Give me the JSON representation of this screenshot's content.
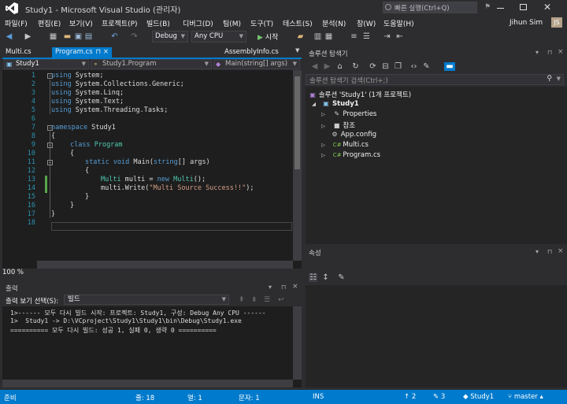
{
  "window": {
    "title": "Study1 - Microsoft Visual Studio (관리자)",
    "quick_launch_placeholder": "빠른 실행(Ctrl+Q)",
    "user": "Jihun Sim",
    "avatar_initials": "JS"
  },
  "menu": [
    "파일(F)",
    "편집(E)",
    "보기(V)",
    "프로젝트(P)",
    "빌드(B)",
    "디버그(D)",
    "팀(M)",
    "도구(T)",
    "테스트(S)",
    "분석(N)",
    "창(W)",
    "도움말(H)"
  ],
  "toolbar": {
    "config": "Debug",
    "platform": "Any CPU",
    "start_label": "시작"
  },
  "editor": {
    "tabs": [
      {
        "label": "Multi.cs",
        "active": false
      },
      {
        "label": "Program.cs",
        "active": true,
        "extra": "⊓ ×"
      },
      {
        "label": "AssemblyInfo.cs",
        "active": false
      }
    ],
    "nav": {
      "project": "Study1",
      "class": "Study1.Program",
      "member": "Main(string[] args)"
    },
    "line_numbers": [
      "1",
      "2",
      "3",
      "4",
      "5",
      "6",
      "7",
      "8",
      "9",
      "10",
      "11",
      "12",
      "13",
      "14",
      "15",
      "16",
      "17",
      "18"
    ],
    "code": {
      "l1_kw": "using",
      "l1_rest": " System;",
      "l2_kw": "using",
      "l2_rest": " System.Collections.Generic;",
      "l3_kw": "using",
      "l3_rest": " System.Linq;",
      "l4_kw": "using",
      "l4_rest": " System.Text;",
      "l5_kw": "using",
      "l5_rest": " System.Threading.Tasks;",
      "l7_kw": "namespace",
      "l7_rest": " Study1",
      "l8": "{",
      "l9_kw": "class",
      "l9_ty": " Program",
      "l10": "{",
      "l11_kw1": "static void",
      "l11_rest": " Main(",
      "l11_kw2": "string",
      "l11_rest2": "[] args)",
      "l12": "{",
      "l13_ty": "Multi",
      "l13_a": " multi = ",
      "l13_kw": "new",
      "l13_ty2": " Multi",
      "l13_b": "();",
      "l14_a": "multi.Write(",
      "l14_str": "\"Multi Source Success!!\"",
      "l14_b": ");",
      "l15": "}",
      "l16": "}",
      "l17": "}"
    },
    "zoom": "100 %"
  },
  "output": {
    "title": "출력",
    "from_label": "출력 보기 선택(S):",
    "from_value": "빌드",
    "lines": [
      "1>------ 모두 다시 빌드 시작: 프로젝트: Study1, 구성: Debug Any CPU ------",
      "1>  Study1 -> D:\\VCproject\\Study1\\Study1\\bin\\Debug\\Study1.exe",
      "========== 모두 다시 빌드: 성공 1, 실패 0, 생략 0 =========="
    ]
  },
  "solution_explorer": {
    "title": "솔루션 탐색기",
    "search_placeholder": "솔루션 탐색기 검색(Ctrl+;)",
    "solution": "솔루션 'Study1' (1개 프로젝트)",
    "project": "Study1",
    "items": [
      "Properties",
      "참조",
      "App.config",
      "Multi.cs",
      "Program.cs"
    ]
  },
  "properties": {
    "title": "속성"
  },
  "status": {
    "ready": "준비",
    "line": "줄: 18",
    "col": "열: 1",
    "char": "문자: 1",
    "ins": "INS",
    "up": "2",
    "pencil": "3",
    "repo": "Study1",
    "branch": "master"
  },
  "colors": {
    "accent": "#007acc",
    "keyword": "#569cd6",
    "type": "#4ec9b0",
    "string": "#d69d85",
    "line_number": "#2b91af"
  }
}
